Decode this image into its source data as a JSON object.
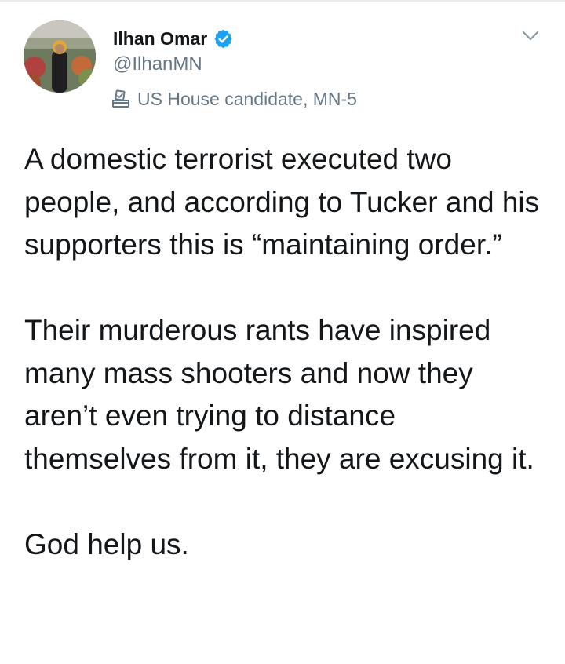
{
  "tweet": {
    "author": {
      "display_name": "Ilhan Omar",
      "handle": "@IlhanMN",
      "verified": true,
      "label_icon": "ballot-box-icon",
      "label": "US House candidate, MN-5"
    },
    "menu_icon": "chevron-down-icon",
    "text": {
      "paragraph_1": "A domestic terrorist executed two people, and according to Tucker and his supporters this is “maintaining order.”",
      "paragraph_2": "Their murderous rants have inspired many mass shooters and now they aren’t even trying to distance themselves from it, they are excusing it.",
      "paragraph_3": "God help us."
    }
  },
  "colors": {
    "text_primary": "#14171a",
    "text_secondary": "#657786",
    "verified_blue": "#1da1f2",
    "divider": "#e6ecf0"
  }
}
